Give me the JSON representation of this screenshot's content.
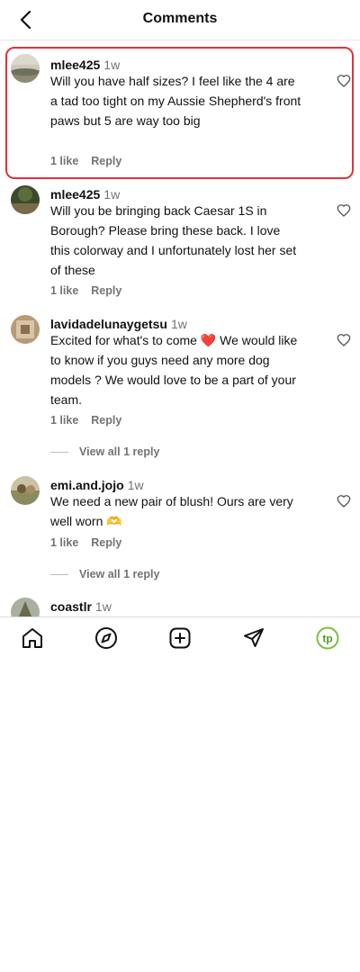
{
  "header": {
    "title": "Comments"
  },
  "comments": [
    {
      "username": "mlee425",
      "time": "1w",
      "text": "Will you have half sizes? I feel like the 4 are a tad too tight on my Aussie Shepherd's front paws but 5 are way too big",
      "likes": "1 like",
      "reply": "Reply"
    },
    {
      "username": "mlee425",
      "time": "1w",
      "text": "Will you be bringing back Caesar 1S in Borough? Please bring these back. I love this colorway and I unfortunately lost her set of these",
      "likes": "1 like",
      "reply": "Reply"
    },
    {
      "username": "lavidadelunaygetsu",
      "time": "1w",
      "text": "Excited for what's to come ❤️ We would like to know if you guys need any more dog models ? We would love to be a part of your team.",
      "likes": "1 like",
      "reply": "Reply",
      "view_replies": "View all 1 reply"
    },
    {
      "username": "emi.and.jojo",
      "time": "1w",
      "text": "We need a new pair of blush! Ours are very well worn 🫶",
      "likes": "1 like",
      "reply": "Reply",
      "view_replies": "View all 1 reply"
    },
    {
      "username": "coastlr",
      "time": "1w"
    }
  ],
  "tabbar": {
    "items": [
      "home-icon",
      "explore-compass-icon",
      "create-plus-icon",
      "direct-send-icon",
      "profile-avatar-icon"
    ],
    "profile_initials": "tp",
    "accent": "#7ac143"
  },
  "colors": {
    "highlight": "#e5303a",
    "secondary_text": "#737373"
  }
}
